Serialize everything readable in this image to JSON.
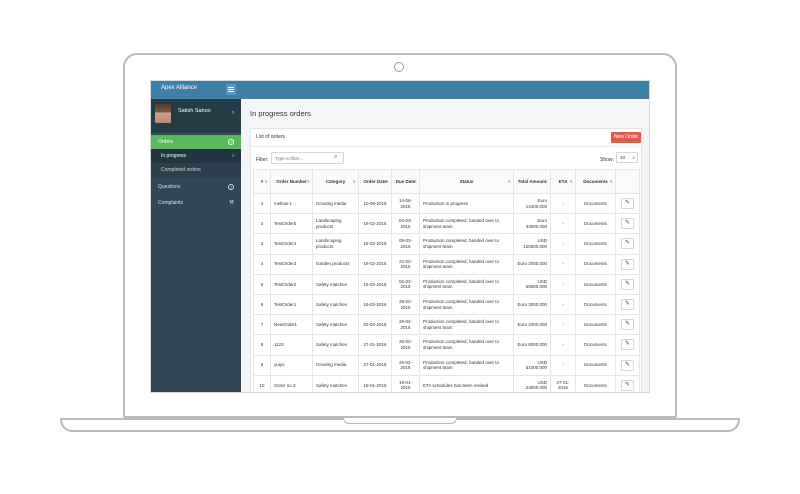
{
  "app": {
    "title": "Apex Alliance"
  },
  "profile": {
    "name": "Satish Sahoo"
  },
  "sidebar": {
    "items": [
      {
        "label": "Orders",
        "icon": "help-circle-icon",
        "glyph": "?"
      },
      {
        "label": "In progress",
        "icon": "chevron-right-icon",
        "glyph": "›"
      },
      {
        "label": "Completed orders"
      },
      {
        "label": "Questions",
        "icon": "help-circle-icon",
        "glyph": "?"
      },
      {
        "label": "Complaints",
        "icon": "wrench-icon",
        "glyph": "⚒"
      }
    ]
  },
  "page": {
    "title": "In progress orders"
  },
  "panel": {
    "title": "List of orders",
    "new_order_label": "New Order",
    "filter_label": "Filter:",
    "filter_placeholder": "Type to filter...",
    "show_label": "Show:",
    "show_value": "10"
  },
  "table": {
    "headers": [
      "#",
      "Order Number",
      "Category",
      "Order Date",
      "Due Date",
      "Status",
      "Total Amount",
      "ETA",
      "Documents",
      ""
    ],
    "rows": [
      [
        "1",
        "mellow-1",
        "Growing media",
        "10-06-2016",
        "14-06-2016",
        "Production in progress",
        "Euro 14400.000",
        "-",
        "Documents"
      ],
      [
        "2",
        "TestOrder5",
        "Landscaping products",
        "18-02-2016",
        "04-03-2016",
        "Production completed, handed over to shipment team",
        "Euro 33000.000",
        "-",
        "Documents"
      ],
      [
        "3",
        "TestOrder4",
        "Landscaping products",
        "18-02-2016",
        "05-03-2016",
        "Production completed, handed over to shipment team",
        "USD 120000.000",
        "-",
        "Documents"
      ],
      [
        "4",
        "TestOrder3",
        "Garden products",
        "18-02-2016",
        "22-02-2016",
        "Production completed, handed over to shipment team",
        "Euro 2000.000",
        "-",
        "Documents"
      ],
      [
        "5",
        "TestOrder2",
        "Safety matches",
        "16-02-2016",
        "02-03-2016",
        "Production completed, handed over to shipment team",
        "USD 69000.000",
        "-",
        "Documents"
      ],
      [
        "6",
        "TestOrder1",
        "Safety matches",
        "16-02-2016",
        "29-02-2016",
        "Production completed, handed over to shipment team",
        "Euro 3000.000",
        "-",
        "Documents"
      ],
      [
        "7",
        "NewOrder1",
        "Safety matches",
        "02-02-2016",
        "29-02-2016",
        "Production completed, handed over to shipment team",
        "Euro 2000.000",
        "-",
        "Documents"
      ],
      [
        "8",
        "1123",
        "Safety matches",
        "27-01-2016",
        "26-02-2016",
        "Production completed, handed over to shipment team",
        "Euro 8000.000",
        "-",
        "Documents"
      ],
      [
        "9",
        "yuiyu",
        "Growing media",
        "27-01-2016",
        "25-02-2016",
        "Production completed, handed over to shipment team",
        "USD 51000.000",
        "-",
        "Documents"
      ],
      [
        "10",
        "Order no 3",
        "Safety matches",
        "18-01-2016",
        "19-01-2016",
        "ETA schedules has been revised",
        "USD 23000.000",
        "27-01-2016",
        "Documents"
      ]
    ]
  },
  "colors": {
    "topbar": "#3d7fa6",
    "sidebar": "#2f4854",
    "active": "#5cb85c",
    "new_order": "#e05b4b"
  }
}
